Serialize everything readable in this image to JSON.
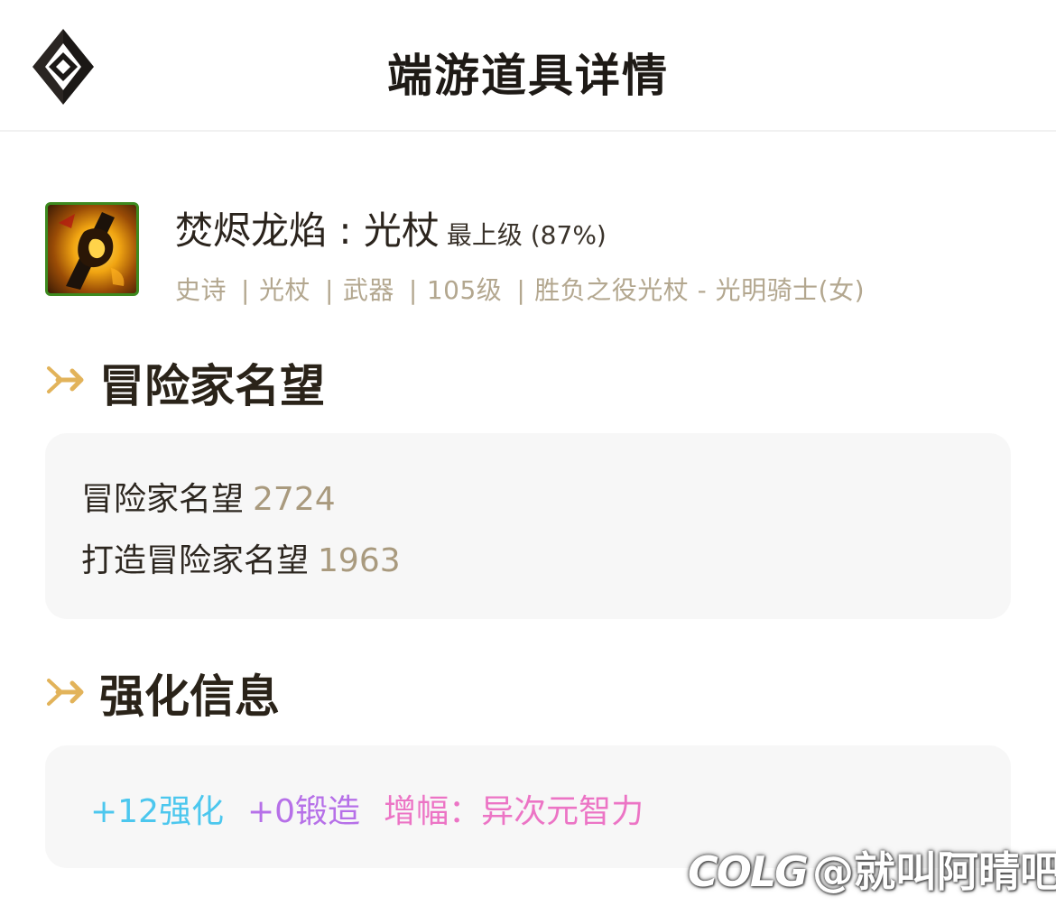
{
  "header": {
    "title": "端游道具详情",
    "logo_icon": "diamond-logo-icon"
  },
  "item": {
    "name": "焚烬龙焰 : 光杖",
    "grade": "最上级 (87%)",
    "meta": [
      "史诗",
      "光杖",
      "武器",
      "105级",
      "胜负之役光杖 - 光明骑士(女)"
    ],
    "icon": "flame-staff-icon",
    "border_color": "#3d8a1f"
  },
  "sections": {
    "reputation": {
      "title": "冒险家名望",
      "rows": [
        {
          "label": "冒险家名望",
          "value": "2724"
        },
        {
          "label": "打造冒险家名望",
          "value": "1963"
        }
      ]
    },
    "enhance": {
      "title": "强化信息",
      "reinforce": "+12强化",
      "forge": "+0锻造",
      "amplify": "增幅：异次元智力"
    }
  },
  "colors": {
    "accent_gold": "#e2b35a",
    "reinforce": "#4cc7ee",
    "forge": "#b670e8",
    "amplify": "#ec74c5",
    "value_tan": "#a99a7e"
  },
  "watermark": {
    "logo": "COLG",
    "text": "@就叫阿晴吧"
  }
}
